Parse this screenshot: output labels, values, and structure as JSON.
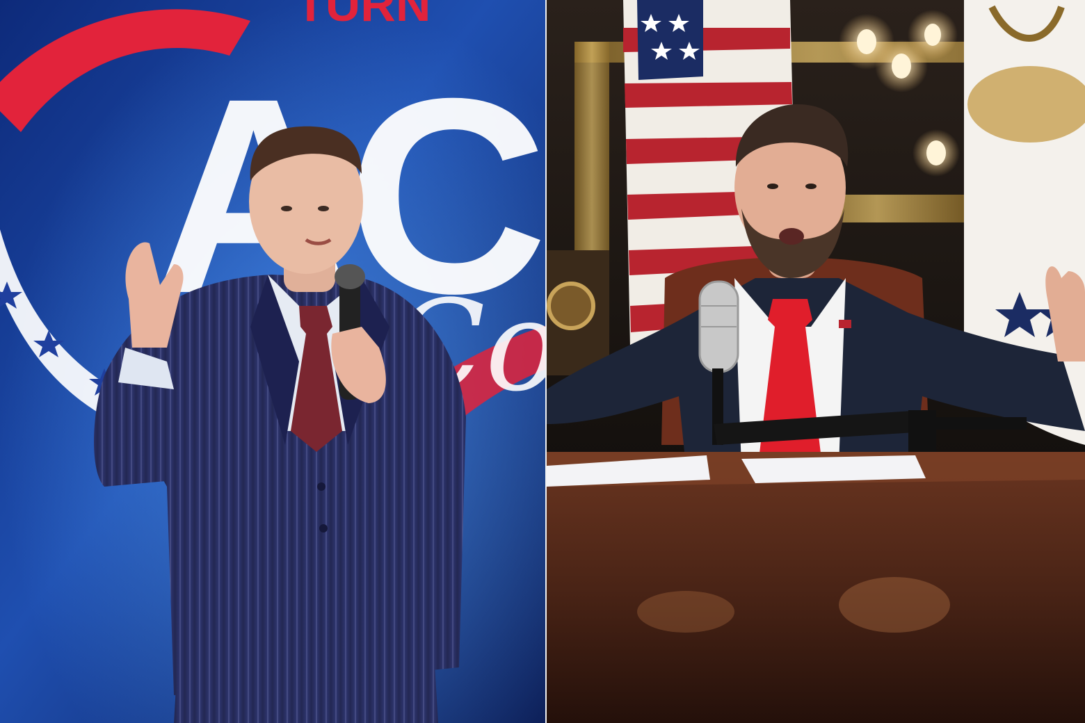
{
  "left_photo": {
    "backdrop_text_top": "TURN",
    "backdrop_text_main": "AC",
    "backdrop_text_script": "Co",
    "colors": {
      "stage_blue": "#1f4fb0",
      "stage_red": "#e2233b",
      "suit": "#2a2f5c",
      "tie": "#7a2630"
    }
  },
  "right_photo": {
    "colors": {
      "suit": "#1d2538",
      "tie": "#e01e2b",
      "desk": "#4a2416",
      "flag_red": "#b8242f"
    }
  }
}
